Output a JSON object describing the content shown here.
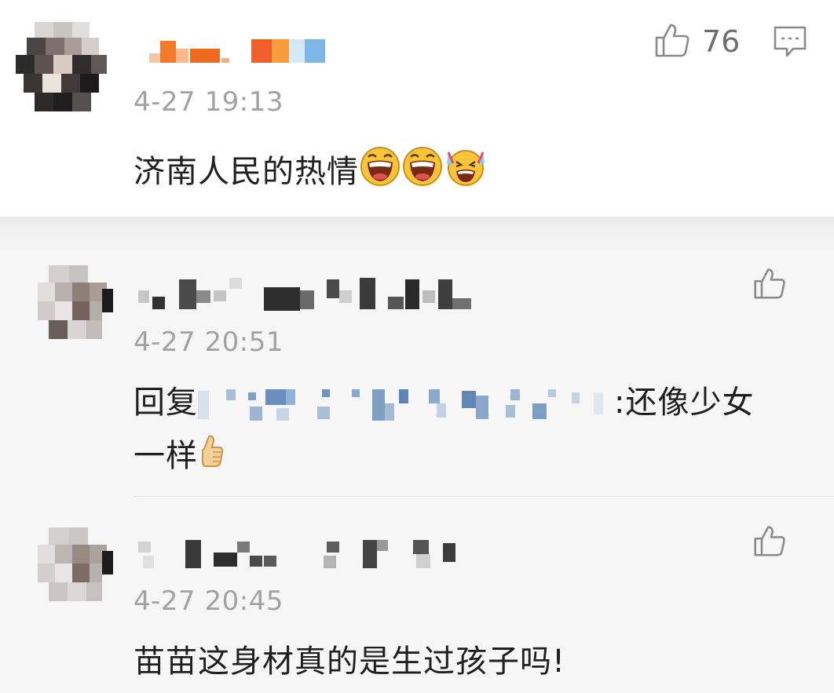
{
  "comments": [
    {
      "time": "4-27 19:13",
      "text": "济南人民的热情",
      "emoji": [
        "grinning-face-icon",
        "grinning-face-icon",
        "tears-of-joy-face-icon"
      ],
      "like_count": "76"
    },
    {
      "time": "4-27 20:51",
      "reply_prefix": "回复",
      "reply_text_line1": ":还像少女",
      "reply_text_line2": "一样",
      "emoji": [
        "thumbs-up-icon"
      ]
    },
    {
      "time": "4-27 20:45",
      "text": "苗苗这身材真的是生过孩子吗!"
    }
  ],
  "colors": {
    "background_top": "#ffffff",
    "background_replies": "#f6f6f6",
    "meta_text": "#a2a2a2",
    "body_text": "#1f1f1f",
    "icon_stroke": "#8a8a8a"
  }
}
